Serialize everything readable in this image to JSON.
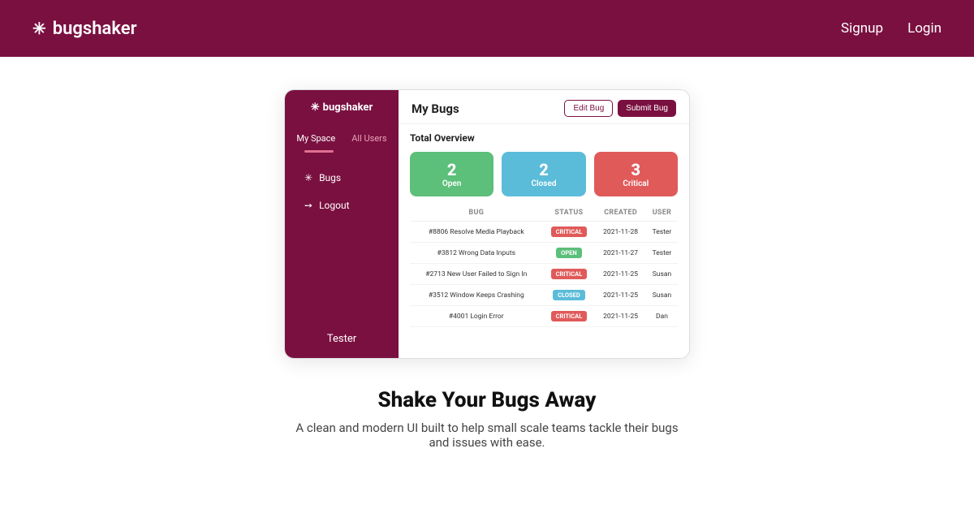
{
  "header": {
    "logo_icon": "✳",
    "logo_text": "bugshaker",
    "nav": [
      {
        "label": "Signup",
        "name": "signup-link"
      },
      {
        "label": "Login",
        "name": "login-link"
      }
    ]
  },
  "sidebar": {
    "logo_icon": "✳",
    "logo_text": "bugshaker",
    "nav_items": [
      {
        "label": "My Space",
        "active": true
      },
      {
        "label": "All Users",
        "active": false
      }
    ],
    "menu_items": [
      {
        "icon": "✳",
        "label": "Bugs"
      },
      {
        "icon": "➙",
        "label": "Logout"
      }
    ],
    "user": "Tester"
  },
  "main": {
    "title": "My Bugs",
    "edit_btn": "Edit Bug",
    "submit_btn": "Submit Bug",
    "overview": {
      "title": "Total Overview",
      "stats": [
        {
          "count": 2,
          "label": "Open",
          "type": "open"
        },
        {
          "count": 2,
          "label": "Closed",
          "type": "closed"
        },
        {
          "count": 3,
          "label": "Critical",
          "type": "critical"
        }
      ]
    },
    "table": {
      "columns": [
        "BUG",
        "STATUS",
        "CREATED",
        "USER"
      ],
      "rows": [
        {
          "bug": "#8806 Resolve Media Playback",
          "status": "CRITICAL",
          "status_type": "critical",
          "created": "2021-11-28",
          "user": "Tester"
        },
        {
          "bug": "#3812 Wrong Data Inputs",
          "status": "OPEN",
          "status_type": "open",
          "created": "2021-11-27",
          "user": "Tester"
        },
        {
          "bug": "#2713 New User Failed to Sign In",
          "status": "CRITICAL",
          "status_type": "critical",
          "created": "2021-11-25",
          "user": "Susan"
        },
        {
          "bug": "#3512 Window Keeps Crashing",
          "status": "CLOSED",
          "status_type": "closed",
          "created": "2021-11-25",
          "user": "Susan"
        },
        {
          "bug": "#4001 Login Error",
          "status": "CRITICAL",
          "status_type": "critical",
          "created": "2021-11-25",
          "user": "Dan"
        }
      ]
    }
  },
  "tagline": {
    "heading": "Shake Your Bugs Away",
    "description": "A clean and modern UI built to help small scale teams tackle their bugs and issues with ease."
  }
}
